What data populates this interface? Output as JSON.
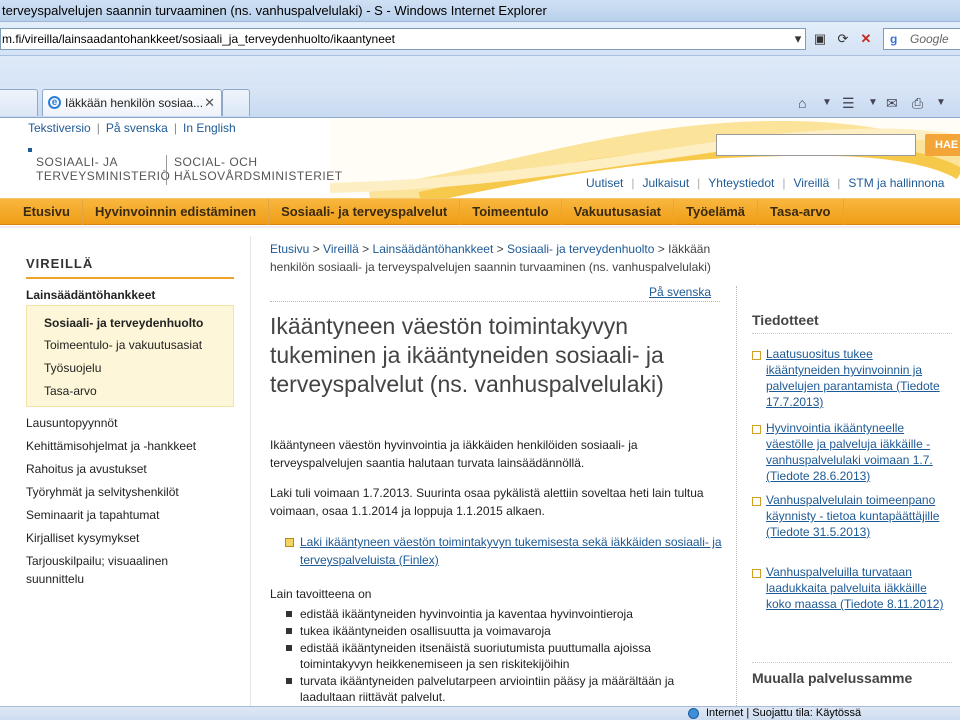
{
  "browser": {
    "window_title": "terveyspalvelujen saannin turvaaminen (ns. vanhuspalvelulaki) - S - Windows Internet Explorer",
    "address": "m.fi/vireilla/lainsaadantohankkeet/sosiaali_ja_terveydenhuolto/ikaantyneet",
    "search_placeholder": "Google",
    "tab_title": "Iäkkään henkilön sosiaa...",
    "tab_close": "✕",
    "status_text": "Internet | Suojattu tila: Käytössä"
  },
  "site": {
    "lang_links": [
      "Tekstiversio",
      "På svenska",
      "In English"
    ],
    "logo_fi": [
      "SOSIAALI- JA",
      "TERVEYSMINISTERIÖ"
    ],
    "logo_sv": [
      "SOCIAL- OCH",
      "HÄLSOVÅRDSMINISTERIET"
    ],
    "search_button": "HAE",
    "service_nav": [
      "Uutiset",
      "Julkaisut",
      "Yhteystiedot",
      "Vireillä",
      "STM ja hallinnona"
    ],
    "main_nav": [
      "Etusivu",
      "Hyvinvoinnin edistäminen",
      "Sosiaali- ja terveyspalvelut",
      "Toimeentulo",
      "Vakuutusasiat",
      "Työelämä",
      "Tasa-arvo"
    ]
  },
  "left_nav": {
    "title": "VIREILLÄ",
    "section": "Lainsäädäntöhankkeet",
    "sub_items": [
      "Sosiaali- ja terveydenhuolto",
      "Toimeentulo- ja vakuutusasiat",
      "Työsuojelu",
      "Tasa-arvo"
    ],
    "items": [
      "Lausuntopyynnöt",
      "Kehittämisohjelmat ja -hankkeet",
      "Rahoitus ja avustukset",
      "Työryhmät ja selvityshenkilöt",
      "Seminaarit ja tapahtumat",
      "Kirjalliset kysymykset",
      "Tarjouskilpailu; visuaalinen suunnittelu"
    ]
  },
  "main": {
    "breadcrumb": {
      "links": [
        "Etusivu",
        "Vireillä",
        "Lainsäädäntöhankkeet",
        "Sosiaali- ja terveydenhuolto"
      ],
      "current": "Iäkkään henkilön sosiaali- ja terveyspalvelujen saannin turvaaminen (ns. vanhuspalvelulaki)"
    },
    "sv_link": "På svenska",
    "title": "Ikääntyneen väestön toimintakyvyn tukeminen ja ikääntyneiden sosiaali- ja terveyspalvelut (ns. vanhuspalvelulaki)",
    "para1": "Ikääntyneen väestön hyvinvointia ja iäkkäiden henkilöiden sosiaali- ja terveyspalvelujen saantia halutaan turvata lainsäädännöllä.",
    "para2": "Laki tuli voimaan 1.7.2013. Suurinta osaa pykälistä alettiin soveltaa heti lain tultua voimaan, osaa 1.1.2014 ja loppuja 1.1.2015 alkaen.",
    "finlex_link": "Laki ikääntyneen väestön toimintakyvyn tukemisesta sekä iäkkäiden sosiaali- ja terveyspalveluista (Finlex)",
    "goals_intro": "Lain tavoitteena on",
    "goals": [
      "edistää ikääntyneiden hyvinvointia ja kaventaa hyvinvointieroja",
      "tukea ikääntyneiden osallisuutta ja voimavaroja",
      "edistää ikääntyneiden itsenäistä suoriutumista puuttumalla ajoissa toimintakyvyn heikkenemiseen ja sen riskitekijöihin",
      "turvata ikääntyneiden palvelutarpeen arviointiin pääsy ja määrältään ja laadultaan riittävät palvelut."
    ]
  },
  "right": {
    "title": "Tiedotteet",
    "news": [
      "Laatusuositus tukee ikääntyneiden hyvinvoinnin ja palvelujen parantamista (Tiedote 17.7.2013)",
      "Hyvinvointia ikääntyneelle väestölle ja palveluja iäkkäille - vanhuspalvelulaki voimaan 1.7. (Tiedote 28.6.2013)",
      "Vanhuspalvelulain toimeenpano käynnisty - tietoa kuntapäättäjille (Tiedote 31.5.2013)",
      "Vanhuspalveluilla turvataan laadukkaita palveluita iäkkäille koko maassa (Tiedote 8.11.2012)"
    ],
    "other_title": "Muualla palvelussamme"
  },
  "colors": {
    "accent": "#f0a32a",
    "link": "#1e5a96"
  }
}
